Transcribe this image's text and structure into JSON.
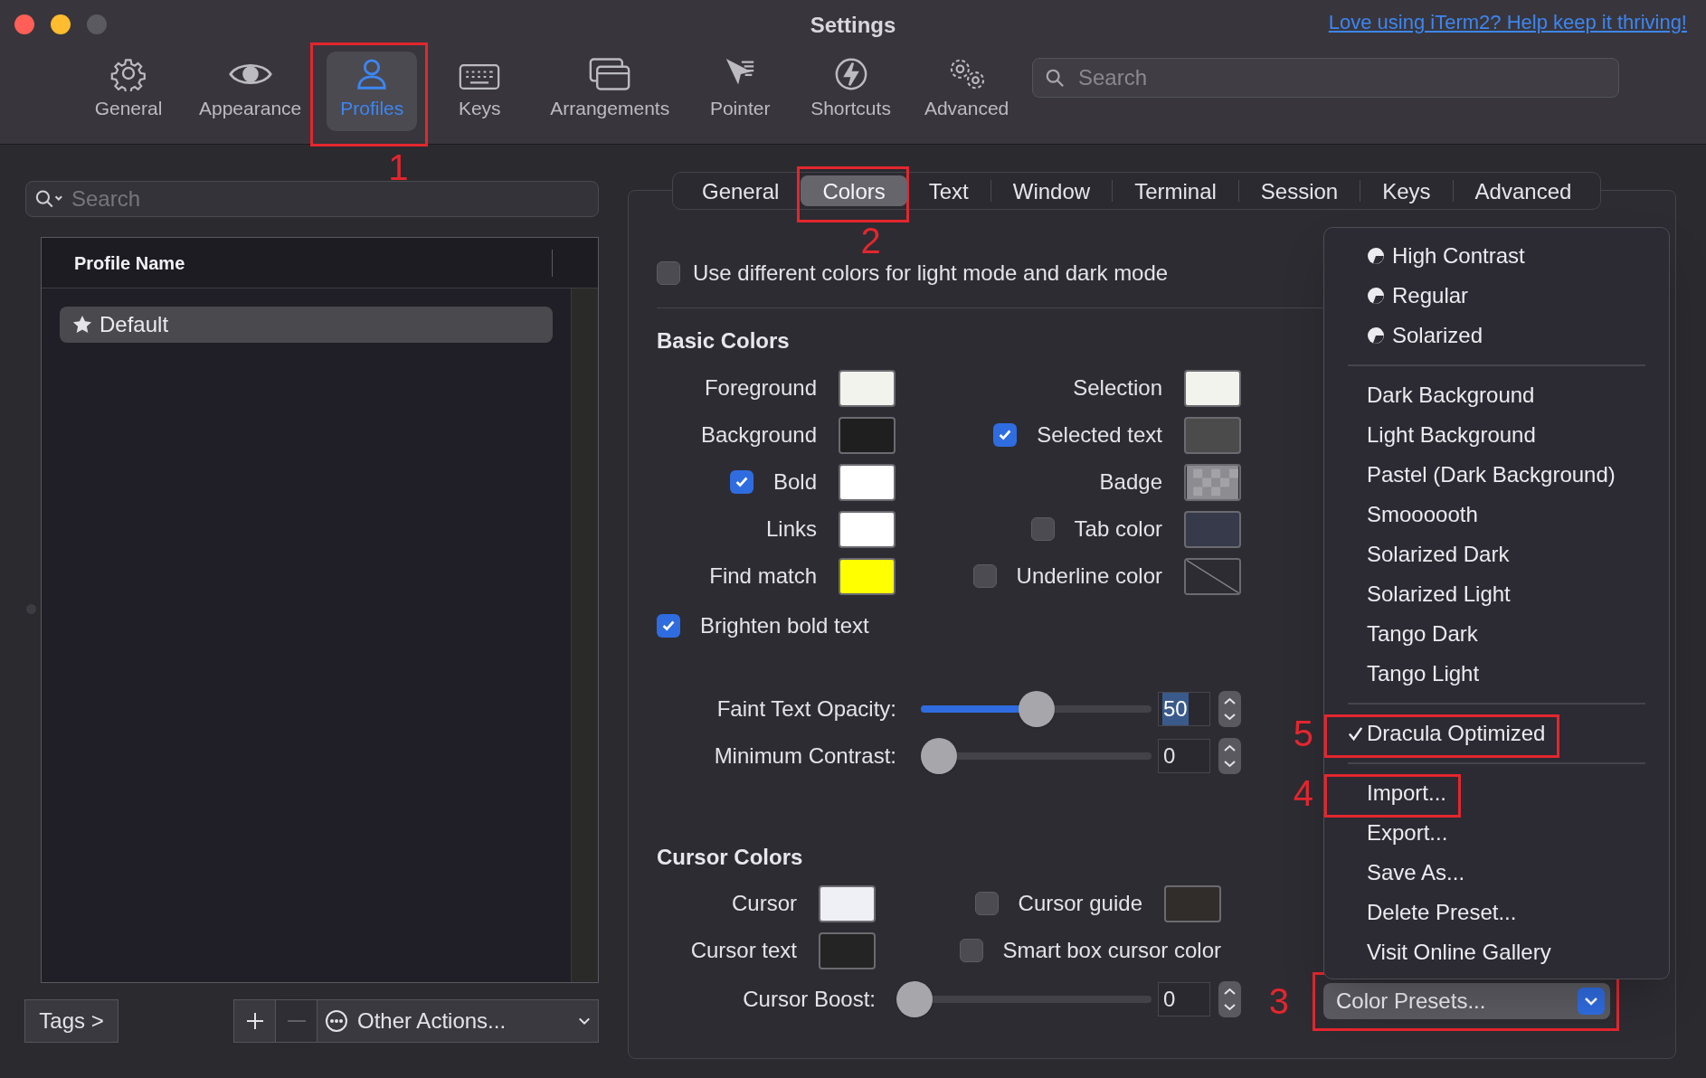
{
  "window": {
    "title": "Settings",
    "link": "Love using iTerm2? Help keep it thriving!"
  },
  "toolbar": {
    "items": [
      {
        "label": "General",
        "selected": false
      },
      {
        "label": "Appearance",
        "selected": false
      },
      {
        "label": "Profiles",
        "selected": true,
        "annotation": "1"
      },
      {
        "label": "Keys",
        "selected": false
      },
      {
        "label": "Arrangements",
        "selected": false
      },
      {
        "label": "Pointer",
        "selected": false
      },
      {
        "label": "Shortcuts",
        "selected": false
      },
      {
        "label": "Advanced",
        "selected": false
      }
    ],
    "search": {
      "placeholder": "Search"
    }
  },
  "profiles": {
    "search": {
      "placeholder": "Search"
    },
    "column": "Profile Name",
    "rows": [
      {
        "name": "Default",
        "selected": true
      }
    ],
    "tags_button": "Tags >",
    "remove_disabled": true,
    "other_actions": "Other Actions..."
  },
  "tabs": [
    {
      "label": "General",
      "selected": false
    },
    {
      "label": "Colors",
      "selected": true,
      "annotation": "2"
    },
    {
      "label": "Text",
      "selected": false
    },
    {
      "label": "Window",
      "selected": false
    },
    {
      "label": "Terminal",
      "selected": false
    },
    {
      "label": "Session",
      "selected": false
    },
    {
      "label": "Keys",
      "selected": false
    },
    {
      "label": "Advanced",
      "selected": false
    }
  ],
  "colors": {
    "light_dark": {
      "label": "Use different colors for light mode and dark mode",
      "checked": false
    },
    "basic": {
      "heading": "Basic Colors",
      "rows": [
        {
          "left": {
            "label": "Foreground",
            "swatch": {
              "kind": "solid",
              "color": "#f3f3ee"
            }
          },
          "right": {
            "label": "Selection",
            "swatch": {
              "kind": "solid",
              "color": "#f3f3ee"
            }
          }
        },
        {
          "left": {
            "label": "Background",
            "swatch": {
              "kind": "solid",
              "color": "#1f1f1f"
            }
          },
          "right": {
            "label": "Selected text",
            "checked": true,
            "swatch": {
              "kind": "solid",
              "color": "#4b4b4b"
            }
          }
        },
        {
          "left": {
            "label": "Bold",
            "checked": true,
            "swatch": {
              "kind": "solid",
              "color": "#ffffff"
            }
          },
          "right": {
            "label": "Badge",
            "swatch": {
              "kind": "checker"
            }
          }
        },
        {
          "left": {
            "label": "Links",
            "swatch": {
              "kind": "solid",
              "color": "#ffffff"
            }
          },
          "right": {
            "label": "Tab color",
            "checked": false,
            "swatch": {
              "kind": "solid",
              "color": "#363a4a"
            }
          }
        },
        {
          "left": {
            "label": "Find match",
            "swatch": {
              "kind": "solid",
              "color": "#ffff00"
            }
          },
          "right": {
            "label": "Underline color",
            "checked": false,
            "swatch": {
              "kind": "none"
            }
          }
        }
      ]
    },
    "brighten": {
      "label": "Brighten bold text",
      "checked": true
    },
    "sliders": [
      {
        "label": "Faint Text Opacity:",
        "level": 0.5,
        "value": "50",
        "value_selected": true
      },
      {
        "label": "Minimum Contrast:",
        "level": 0,
        "value": "0",
        "value_selected": false
      }
    ],
    "cursor": {
      "heading": "Cursor Colors",
      "rows": [
        {
          "left": {
            "label": "Cursor",
            "swatch": {
              "kind": "solid",
              "color": "#eef0f5"
            }
          },
          "right": {
            "label": "Cursor guide",
            "checked": false,
            "swatch": {
              "kind": "solid",
              "color": "#302d2a"
            }
          }
        },
        {
          "left": {
            "label": "Cursor text",
            "swatch": {
              "kind": "solid",
              "color": "#242424"
            }
          },
          "right": {
            "label": "Smart box cursor color",
            "checked": false
          }
        }
      ]
    },
    "boost": {
      "label": "Cursor Boost:",
      "level": 0,
      "value": "0",
      "value_selected": false
    }
  },
  "presets_menu": {
    "groups": [
      [
        {
          "label": "High Contrast",
          "kind": "builtin",
          "checked": false
        },
        {
          "label": "Regular",
          "kind": "builtin",
          "checked": false
        },
        {
          "label": "Solarized",
          "kind": "builtin",
          "checked": false
        }
      ],
      [
        {
          "label": "Dark Background",
          "kind": "preset",
          "checked": false
        },
        {
          "label": "Light Background",
          "kind": "preset",
          "checked": false
        },
        {
          "label": "Pastel (Dark Background)",
          "kind": "preset",
          "checked": false
        },
        {
          "label": "Smoooooth",
          "kind": "preset",
          "checked": false
        },
        {
          "label": "Solarized Dark",
          "kind": "preset",
          "checked": false
        },
        {
          "label": "Solarized Light",
          "kind": "preset",
          "checked": false
        },
        {
          "label": "Tango Dark",
          "kind": "preset",
          "checked": false
        },
        {
          "label": "Tango Light",
          "kind": "preset",
          "checked": false
        }
      ],
      [
        {
          "label": "Dracula Optimized",
          "kind": "preset",
          "checked": true,
          "annotation": "5"
        }
      ],
      [
        {
          "label": "Import...",
          "kind": "action",
          "checked": false,
          "annotation": "4"
        },
        {
          "label": "Export...",
          "kind": "action",
          "checked": false
        },
        {
          "label": "Save As...",
          "kind": "action",
          "checked": false
        },
        {
          "label": "Delete Preset...",
          "kind": "action",
          "checked": false
        },
        {
          "label": "Visit Online Gallery",
          "kind": "action",
          "checked": false
        }
      ]
    ]
  },
  "presets_button": {
    "label": "Color Presets...",
    "annotation": "3"
  }
}
